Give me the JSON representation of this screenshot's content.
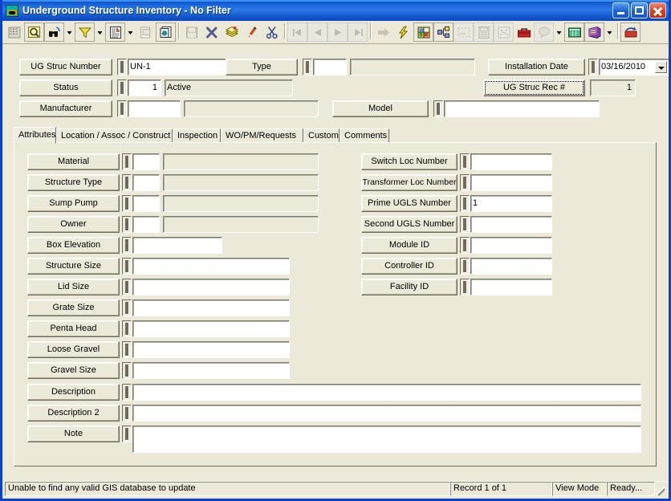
{
  "window": {
    "title": "Underground Structure Inventory - No Filter",
    "icon": "underground-structure-icon",
    "minimize_label": "Minimize",
    "maximize_label": "Maximize",
    "close_label": "Close"
  },
  "toolbar": {
    "buttons": [
      {
        "name": "grid-view-icon",
        "enabled": false
      },
      {
        "name": "query-search-icon",
        "enabled": true
      },
      {
        "name": "find-binoculars-icon",
        "enabled": true
      },
      {
        "name": "find-dropdown-icon",
        "enabled": true
      },
      {
        "name": "filter-funnel-icon",
        "enabled": true
      },
      {
        "name": "filter-dropdown-icon",
        "enabled": true
      },
      {
        "name": "report-icon",
        "enabled": true
      },
      {
        "name": "report-dropdown-icon",
        "enabled": true
      },
      {
        "name": "print-preview-icon",
        "enabled": false
      },
      {
        "name": "copy-record-icon",
        "enabled": true
      },
      {
        "name": "save-icon",
        "enabled": false
      },
      {
        "name": "delete-icon",
        "enabled": true
      },
      {
        "name": "new-record-icon",
        "enabled": true
      },
      {
        "name": "edit-pencil-icon",
        "enabled": true
      },
      {
        "name": "cut-scissors-icon",
        "enabled": true
      },
      {
        "name": "first-record-icon",
        "enabled": false
      },
      {
        "name": "previous-record-icon",
        "enabled": false
      },
      {
        "name": "next-record-icon",
        "enabled": false
      },
      {
        "name": "last-record-icon",
        "enabled": false
      },
      {
        "name": "goto-record-icon",
        "enabled": false
      },
      {
        "name": "lightning-action-icon",
        "enabled": true
      },
      {
        "name": "map-view-icon",
        "enabled": true
      },
      {
        "name": "tree-hierarchy-icon",
        "enabled": true
      },
      {
        "name": "dotted-select-icon",
        "enabled": false
      },
      {
        "name": "calculator-icon",
        "enabled": false
      },
      {
        "name": "scatter-icon",
        "enabled": false
      },
      {
        "name": "toolbox-icon",
        "enabled": true
      },
      {
        "name": "balloon-help-icon",
        "enabled": false
      },
      {
        "name": "balloon-dropdown-icon",
        "enabled": true
      },
      {
        "name": "spreadsheet-icon",
        "enabled": true
      },
      {
        "name": "book-icon",
        "enabled": true
      },
      {
        "name": "book-dropdown-icon",
        "enabled": true
      },
      {
        "name": "gis-update-icon",
        "enabled": true
      }
    ]
  },
  "header": {
    "ug_struc_number": {
      "label": "UG Struc Number",
      "value": "UN-1"
    },
    "type": {
      "label": "Type",
      "code": "",
      "desc": ""
    },
    "installation_date": {
      "label": "Installation Date",
      "value": "03/16/2010"
    },
    "status": {
      "label": "Status",
      "code": "1",
      "desc": "Active"
    },
    "ug_struc_rec": {
      "label": "UG Struc Rec #",
      "value": "1"
    },
    "manufacturer": {
      "label": "Manufacturer",
      "code": "",
      "desc": ""
    },
    "model": {
      "label": "Model",
      "value": ""
    }
  },
  "tabs": [
    {
      "label": "Attributes",
      "selected": true
    },
    {
      "label": "Location / Assoc / Construct",
      "selected": false
    },
    {
      "label": "Inspection",
      "selected": false
    },
    {
      "label": "WO/PM/Requests",
      "selected": false
    },
    {
      "label": "Custom",
      "selected": false
    },
    {
      "label": "Comments",
      "selected": false
    }
  ],
  "attributes": {
    "left_coded": [
      {
        "label": "Material",
        "code": "",
        "desc": ""
      },
      {
        "label": "Structure Type",
        "code": "",
        "desc": ""
      },
      {
        "label": "Sump Pump",
        "code": "",
        "desc": ""
      },
      {
        "label": "Owner",
        "code": "",
        "desc": ""
      }
    ],
    "left_plain": [
      {
        "label": "Box Elevation",
        "value": "",
        "width": "narrow"
      },
      {
        "label": "Structure Size",
        "value": "",
        "width": "wide"
      },
      {
        "label": "Lid Size",
        "value": "",
        "width": "wide"
      },
      {
        "label": "Grate Size",
        "value": "",
        "width": "wide"
      },
      {
        "label": "Penta Head",
        "value": "",
        "width": "wide"
      },
      {
        "label": "Loose Gravel",
        "value": "",
        "width": "wide"
      },
      {
        "label": "Gravel Size",
        "value": "",
        "width": "wide"
      }
    ],
    "right": [
      {
        "label": "Switch Loc Number",
        "value": ""
      },
      {
        "label": "Transformer Loc Number",
        "value": ""
      },
      {
        "label": "Prime UGLS Number",
        "value": "1"
      },
      {
        "label": "Second UGLS Number",
        "value": ""
      },
      {
        "label": "Module ID",
        "value": ""
      },
      {
        "label": "Controller ID",
        "value": ""
      },
      {
        "label": "Facility ID",
        "value": ""
      }
    ],
    "bottom": [
      {
        "label": "Description",
        "value": ""
      },
      {
        "label": "Description 2",
        "value": ""
      },
      {
        "label": "Note",
        "value": ""
      }
    ]
  },
  "statusbar": {
    "message": "Unable to find any valid GIS database to update",
    "record": "Record 1 of 1",
    "mode": "View Mode",
    "ready": "Ready..."
  },
  "colors": {
    "titlebar_blue": "#0a47c0",
    "window_face": "#ece9d8",
    "border_blue": "#0a41cd",
    "field_white": "#ffffff"
  }
}
